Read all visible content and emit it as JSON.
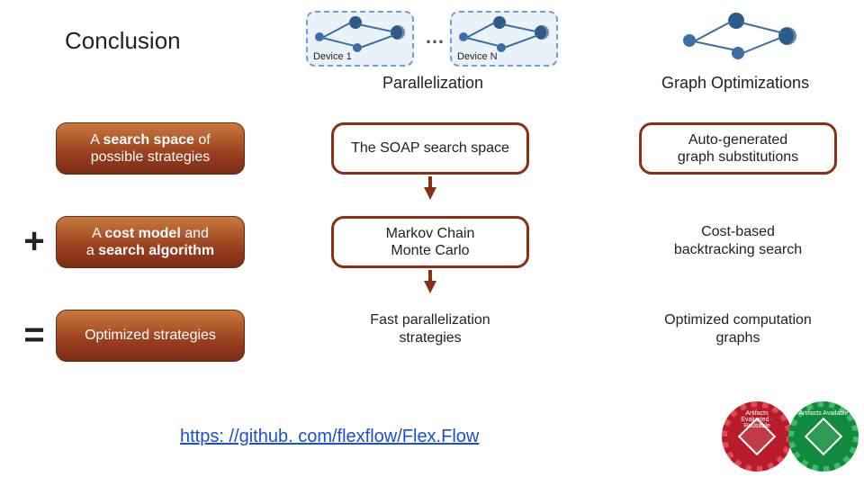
{
  "title": "Conclusion",
  "devices": {
    "d1": "Device 1",
    "dn": "Device N",
    "ellipsis": "…"
  },
  "columns": {
    "parallelization": "Parallelization",
    "graphopt": "Graph Optimizations"
  },
  "left": {
    "search_html": "A <b>search space</b> of<br>possible strategies",
    "cost_html": "A <b>cost model</b> and<br>a <b>search algorithm</b>",
    "result": "Optimized strategies"
  },
  "ops": {
    "plus": "+",
    "equals": "="
  },
  "mid": {
    "soap": "The SOAP search space",
    "mcmc": "Markov Chain\nMonte Carlo",
    "fast": "Fast parallelization\nstrategies"
  },
  "right": {
    "auto": "Auto-generated\ngraph substitutions",
    "backtrack": "Cost-based\nbacktracking search",
    "optgraph": "Optimized computation\ngraphs"
  },
  "link": "https: //github. com/flexflow/Flex.Flow",
  "badges": {
    "red": "Artifacts Evaluated · Reusable",
    "green": "Artifacts Available"
  }
}
